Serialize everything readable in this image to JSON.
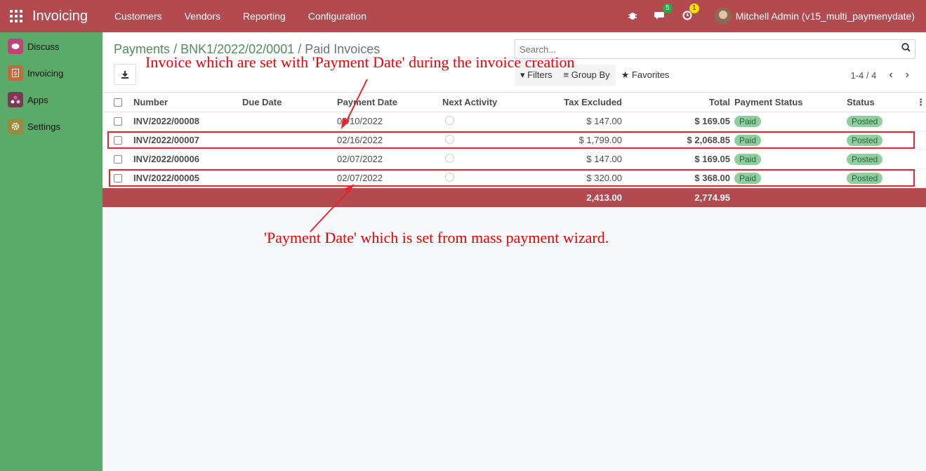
{
  "topbar": {
    "brand": "Invoicing",
    "menu": [
      "Customers",
      "Vendors",
      "Reporting",
      "Configuration"
    ],
    "messages_count": "5",
    "activities_count": "1",
    "user": "Mitchell Admin (v15_multi_paymenydate)"
  },
  "sidebar": {
    "items": [
      {
        "label": "Discuss",
        "icon": "discuss-icon",
        "color": "#c0447a"
      },
      {
        "label": "Invoicing",
        "icon": "invoicing-icon",
        "color": "#c26a3a"
      },
      {
        "label": "Apps",
        "icon": "apps-icon",
        "color": "#7a3a52"
      },
      {
        "label": "Settings",
        "icon": "settings-icon",
        "color": "#9a8a3a"
      }
    ]
  },
  "breadcrumb": {
    "link1": "Payments",
    "link2": "BNK1/2022/02/0001",
    "current": "Paid Invoices"
  },
  "search": {
    "placeholder": "Search..."
  },
  "filters": {
    "filters": "Filters",
    "group_by": "Group By",
    "favorites": "Favorites"
  },
  "pager": {
    "range": "1-4 / 4"
  },
  "table": {
    "headers": {
      "number": "Number",
      "due_date": "Due Date",
      "payment_date": "Payment Date",
      "next_activity": "Next Activity",
      "tax_excluded": "Tax Excluded",
      "total": "Total",
      "payment_status": "Payment Status",
      "status": "Status"
    },
    "rows": [
      {
        "number": "INV/2022/00008",
        "due_date": "",
        "payment_date": "02/10/2022",
        "tax_excluded": "$ 147.00",
        "total": "$ 169.05",
        "payment_status": "Paid",
        "status": "Posted"
      },
      {
        "number": "INV/2022/00007",
        "due_date": "",
        "payment_date": "02/16/2022",
        "tax_excluded": "$ 1,799.00",
        "total": "$ 2,068.85",
        "payment_status": "Paid",
        "status": "Posted"
      },
      {
        "number": "INV/2022/00006",
        "due_date": "",
        "payment_date": "02/07/2022",
        "tax_excluded": "$ 147.00",
        "total": "$ 169.05",
        "payment_status": "Paid",
        "status": "Posted"
      },
      {
        "number": "INV/2022/00005",
        "due_date": "",
        "payment_date": "02/07/2022",
        "tax_excluded": "$ 320.00",
        "total": "$ 368.00",
        "payment_status": "Paid",
        "status": "Posted"
      }
    ],
    "footer": {
      "tax_excluded": "2,413.00",
      "total": "2,774.95"
    }
  },
  "annotations": {
    "top": "Invoice which are set with 'Payment Date' during the invoice creation",
    "bottom": "'Payment Date' which is set from mass payment wizard."
  },
  "colors": {
    "topbar": "#b34a4f",
    "sidebar": "#5aaa6a",
    "annotation": "#e00000"
  }
}
